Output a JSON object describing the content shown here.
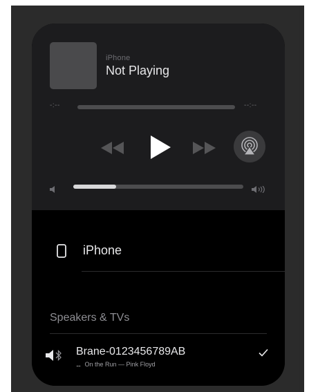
{
  "now_playing": {
    "source": "iPhone",
    "title": "Not Playing",
    "elapsed": "-:--",
    "remaining": "--:--",
    "volume_level": 0.25
  },
  "devices": {
    "iphone_label": "iPhone",
    "section_header": "Speakers & TVs",
    "speaker": {
      "name": "Brane-0123456789AB",
      "now_playing": "On the Run — Pink Floyd",
      "eq_indicator": "....",
      "selected": true
    }
  },
  "icons": {
    "rewind": "rewind-icon",
    "play": "play-icon",
    "fast_forward": "fast-forward-icon",
    "airplay": "airplay-icon",
    "volume_min": "speaker-low-icon",
    "volume_max": "speaker-high-icon",
    "iphone": "iphone-icon",
    "speaker": "bluetooth-speaker-icon",
    "check": "checkmark-icon"
  },
  "colors": {
    "panel": "#1c1c1e",
    "background": "#000000",
    "text_primary": "#e8e8ea",
    "text_secondary": "#8e8e93",
    "volume_fill": "#d8d8da"
  }
}
